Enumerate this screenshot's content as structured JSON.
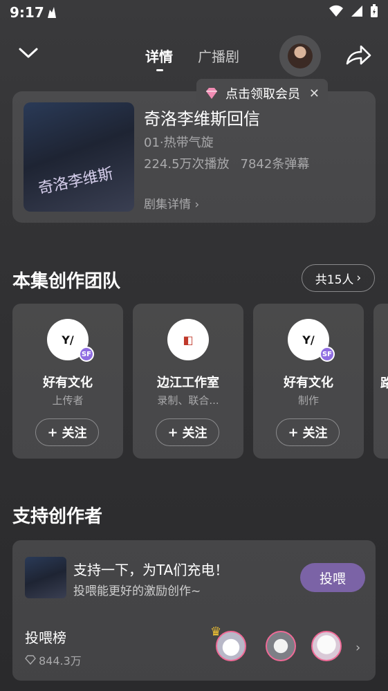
{
  "status_bar": {
    "time": "9:17"
  },
  "header": {
    "tabs": [
      {
        "label": "详情"
      },
      {
        "label": "广播剧"
      }
    ]
  },
  "tooltip": {
    "text": "点击领取会员"
  },
  "show": {
    "title": "奇洛李维斯回信",
    "episode": "01·热带气旋",
    "plays": "224.5万次播放",
    "danmaku": "7842条弹幕",
    "detail_link": "剧集详情",
    "cover_art_text": "奇洛李维斯"
  },
  "team": {
    "title": "本集创作团队",
    "count": "共15人",
    "members": [
      {
        "name": "好有文化",
        "role": "上传者",
        "follow": "关注"
      },
      {
        "name": "边江工作室",
        "role": "录制、联合...",
        "follow": "关注"
      },
      {
        "name": "好有文化",
        "role": "制作",
        "follow": "关注"
      }
    ],
    "partial_name": "路"
  },
  "support": {
    "title": "支持创作者",
    "message": "支持一下，为TA们充电！",
    "sub": "投喂能更好的激励创作~",
    "feed_button": "投喂",
    "rank_title": "投喂榜",
    "rank_total": "844.3万"
  }
}
